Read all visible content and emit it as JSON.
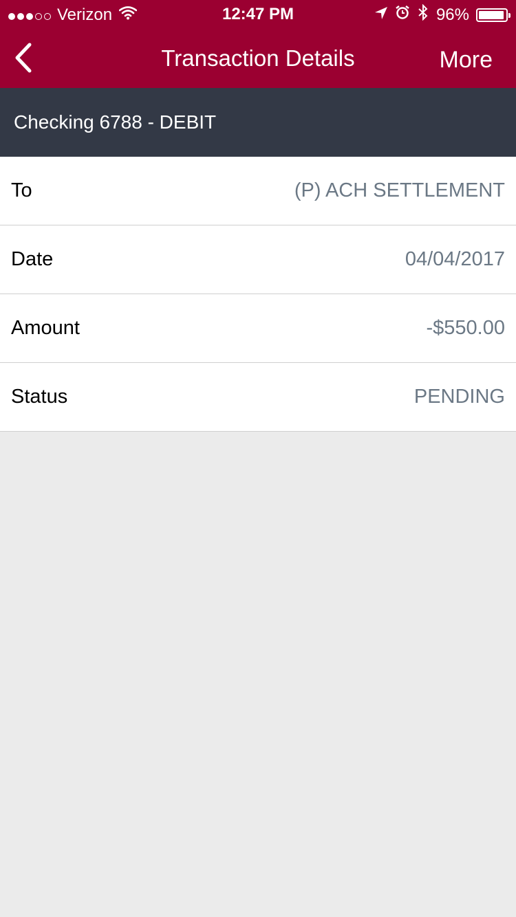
{
  "status_bar": {
    "signal_dots_filled": 3,
    "signal_dots_total": 5,
    "carrier": "Verizon",
    "time": "12:47 PM",
    "battery": "96%",
    "battery_level": 0.96,
    "icons": [
      "wifi-icon",
      "location-arrow-icon",
      "alarm-icon",
      "bluetooth-icon",
      "battery-icon"
    ]
  },
  "nav": {
    "back_icon": "chevron-left-icon",
    "title": "Transaction Details",
    "more_label": "More"
  },
  "account": {
    "header": "Checking 6788 - DEBIT"
  },
  "details": [
    {
      "label": "To",
      "value": "(P) ACH SETTLEMENT"
    },
    {
      "label": "Date",
      "value": "04/04/2017"
    },
    {
      "label": "Amount",
      "value": "-$550.00"
    },
    {
      "label": "Status",
      "value": "PENDING"
    }
  ],
  "colors": {
    "brand": "#9b0031",
    "header_bg": "#333946",
    "value_text": "#6b7885",
    "page_bg": "#ebebeb"
  }
}
